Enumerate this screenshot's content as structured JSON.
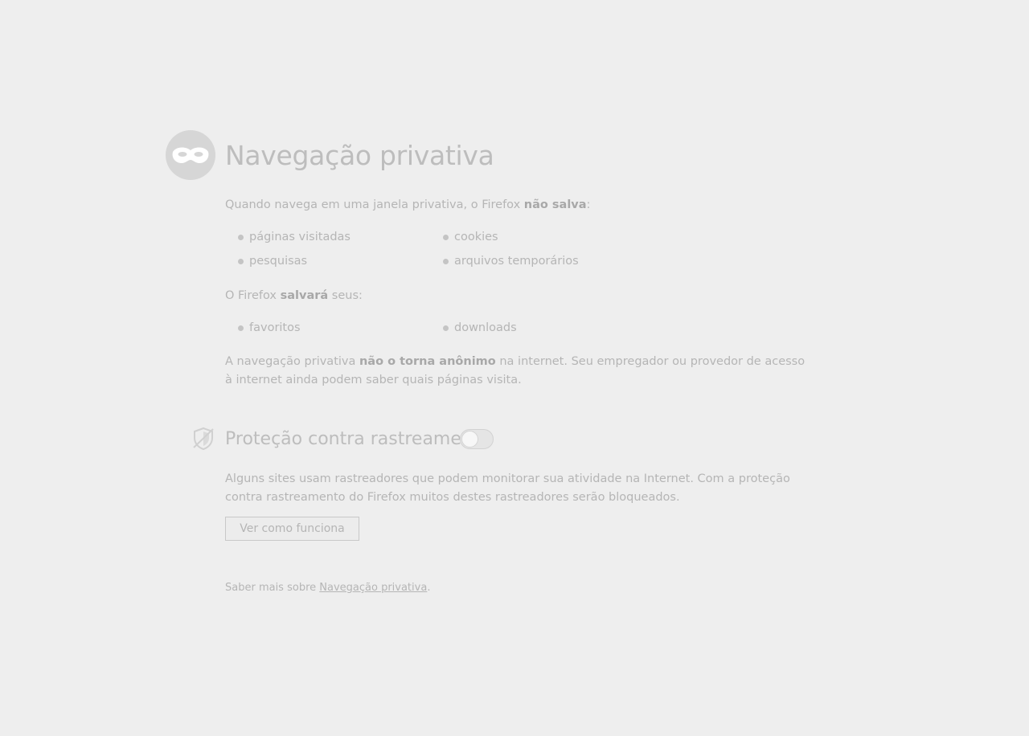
{
  "page": {
    "title": "Navegação privativa"
  },
  "not_saved": {
    "intro_prefix": "Quando navega em uma janela privativa, o Firefox ",
    "intro_bold": "não salva",
    "intro_suffix": ":",
    "items": [
      "páginas visitadas",
      "cookies",
      "pesquisas",
      "arquivos temporários"
    ]
  },
  "will_save": {
    "intro_prefix": "O Firefox ",
    "intro_bold": "salvará",
    "intro_suffix": " seus:",
    "items": [
      "favoritos",
      "downloads"
    ]
  },
  "anonymity": {
    "prefix": "A navegação privativa ",
    "bold": "não o torna anônimo",
    "suffix": " na internet. Seu empregador ou provedor de acesso à internet ainda podem saber quais páginas visita."
  },
  "tracking_protection": {
    "title": "Proteção contra rastreamento",
    "enabled": false,
    "description": "Alguns sites usam rastreadores que podem monitorar sua atividade na Internet. Com a proteção contra rastreamento do Firefox muitos destes rastreadores serão bloqueados.",
    "button_label": "Ver como funciona"
  },
  "footer": {
    "prefix": "Saber mais sobre ",
    "link": "Navegação privativa",
    "suffix": "."
  },
  "icons": {
    "header": "mask-icon",
    "tracking": "shield-icon"
  },
  "colors": {
    "background": "#eeeeee",
    "text": "#b5b5b5"
  }
}
